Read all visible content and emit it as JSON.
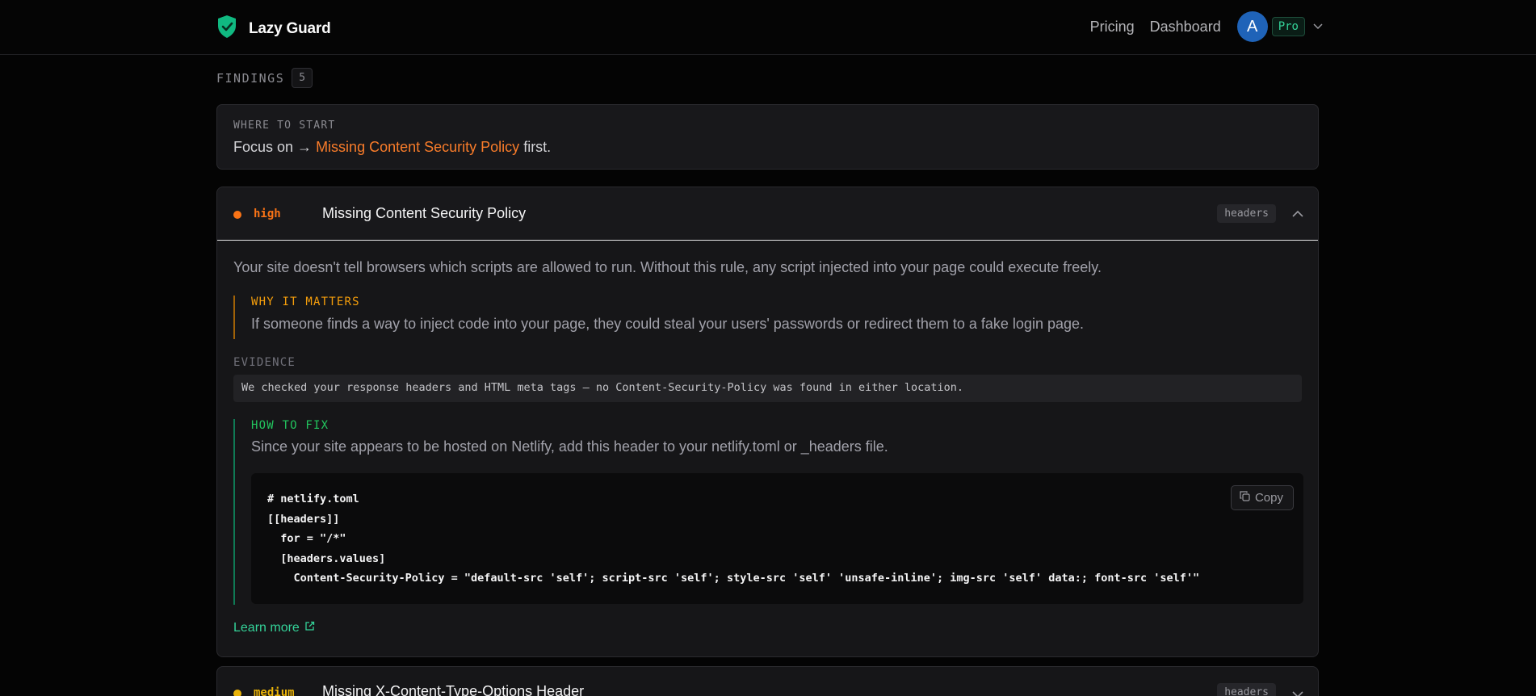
{
  "nav": {
    "brand": "Lazy Guard",
    "links": [
      "Pricing",
      "Dashboard"
    ],
    "avatar_initial": "A",
    "plan_badge": "Pro",
    "accent": "#10b981"
  },
  "findings": {
    "label": "FINDINGS",
    "count": "5"
  },
  "start": {
    "label": "WHERE TO START",
    "prefix": "Focus on →",
    "link": "Missing Content Security Policy",
    "suffix": "first."
  },
  "items": [
    {
      "severity": "high",
      "severity_color": "#f97316",
      "title": "Missing Content Security Policy",
      "tag": "headers",
      "expanded": true,
      "description": "Your site doesn't tell browsers which scripts are allowed to run. Without this rule, any script injected into your page could execute freely.",
      "why_label": "WHY IT MATTERS",
      "why_text": "If someone finds a way to inject code into your page, they could steal your users' passwords or redirect them to a fake login page.",
      "evidence_label": "EVIDENCE",
      "evidence_text": "We checked your response headers and HTML meta tags — no Content-Security-Policy was found in either location.",
      "fix_label": "HOW TO FIX",
      "fix_text": "Since your site appears to be hosted on Netlify, add this header to your netlify.toml or _headers file.",
      "code": "# netlify.toml\n[[headers]]\n  for = \"/*\"\n  [headers.values]\n    Content-Security-Policy = \"default-src 'self'; script-src 'self'; style-src 'self' 'unsafe-inline'; img-src 'self' data:; font-src 'self'\"",
      "copy_label": "Copy",
      "learn_more": "Learn more"
    },
    {
      "severity": "medium",
      "severity_color": "#eab308",
      "title": "Missing X-Content-Type-Options Header",
      "tag": "headers",
      "expanded": false
    }
  ]
}
